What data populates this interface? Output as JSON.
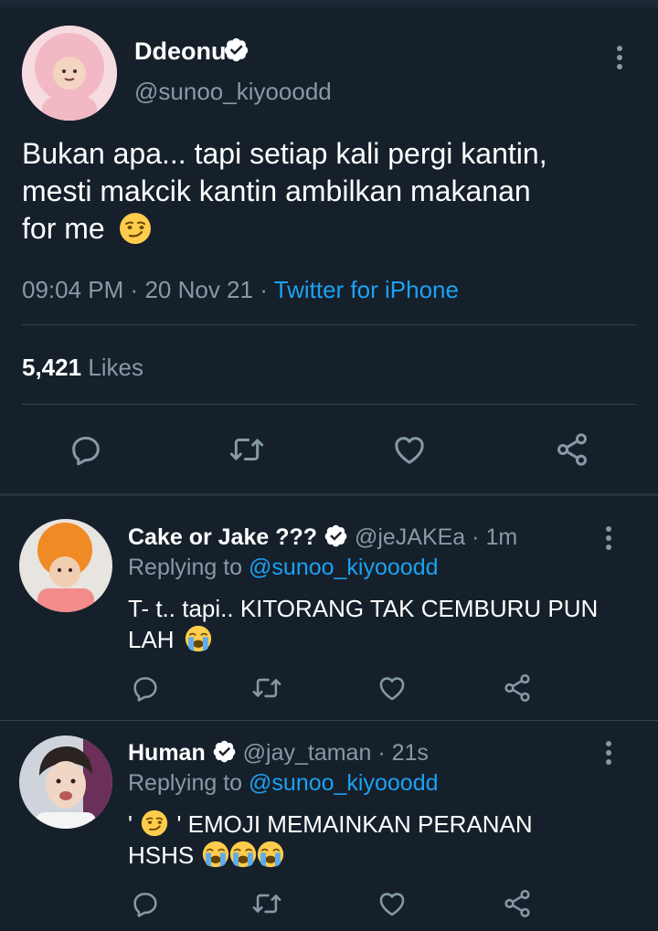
{
  "main_tweet": {
    "display_name": "Ddeonu",
    "handle": "@sunoo_kiyooodd",
    "text_lines": [
      "Bukan apa... tapi setiap kali pergi kantin,",
      "mesti makcik kantin ambilkan makanan",
      "for me"
    ],
    "text_emoji": "smirk-emoji",
    "time": "09:04 PM",
    "sep1": "·",
    "date": "20 Nov 21",
    "sep2": "·",
    "source": "Twitter for iPhone",
    "likes_count": "5,421",
    "likes_label": "Likes"
  },
  "replies": [
    {
      "display_name": "Cake or Jake ???",
      "handle": "@jeJAKEa",
      "sep": "·",
      "age": "1m",
      "replying_label": "Replying to",
      "replying_handle": "@sunoo_kiyooodd",
      "text_lines": [
        "T- t.. tapi.. KITORANG TAK CEMBURU PUN",
        "LAH"
      ],
      "emojis": [
        "crying-emoji"
      ]
    },
    {
      "display_name": "Human",
      "handle": "@jay_taman",
      "sep": "·",
      "age": "21s",
      "replying_label": "Replying to",
      "replying_handle": "@sunoo_kiyooodd",
      "text_pre": "'",
      "text_post": "' EMOJI MEMAINKAN PERANAN",
      "text_line2": "HSHS",
      "emojis": [
        "smirk-emoji",
        "crying-emoji",
        "crying-emoji",
        "crying-emoji"
      ]
    }
  ],
  "icons": [
    "reply-icon",
    "retweet-icon",
    "like-icon",
    "share-icon",
    "more-icon",
    "verified-icon"
  ],
  "colors": {
    "background": "#15202b",
    "accent": "#1da1f2",
    "muted": "#8899a6",
    "divider": "#38444d"
  }
}
